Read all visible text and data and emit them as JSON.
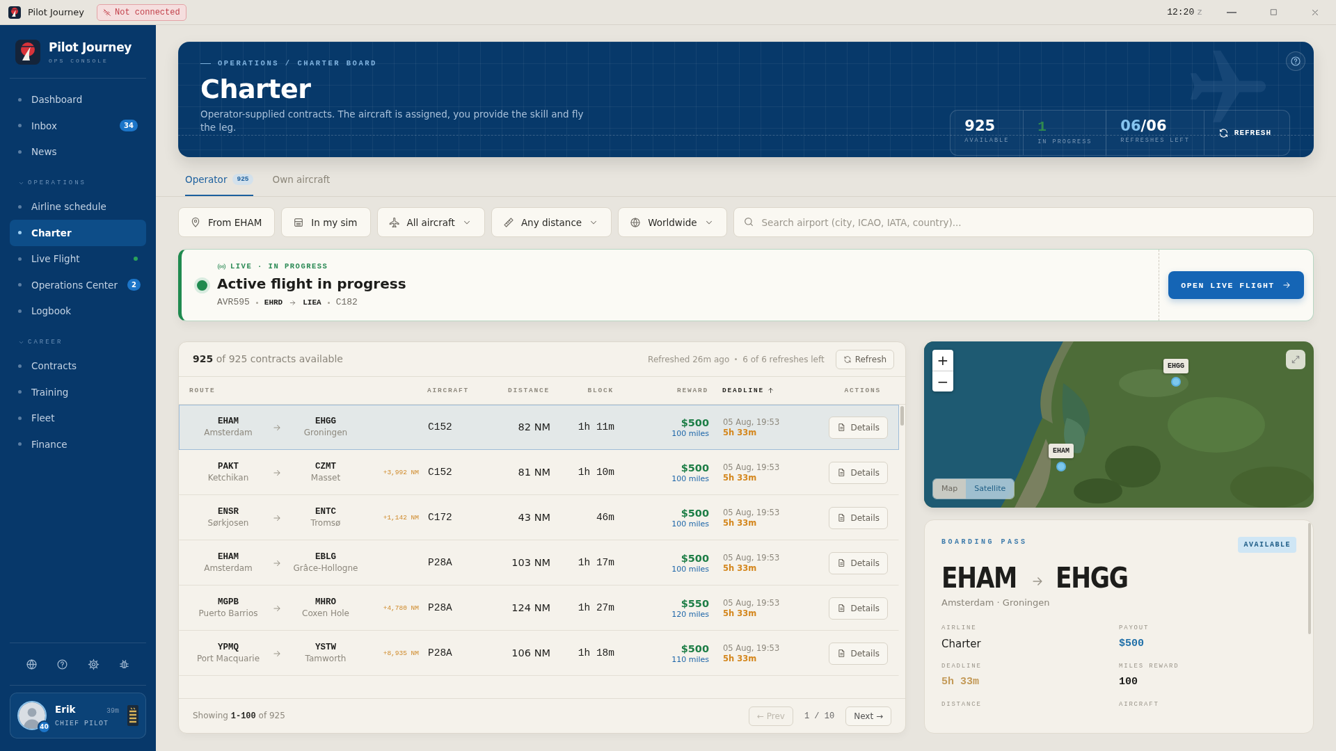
{
  "titlebar": {
    "app_title": "Pilot Journey",
    "connection": "Not connected",
    "clock": "12:20",
    "clock_zone": "z"
  },
  "sidebar": {
    "brand": {
      "name": "Pilot Journey",
      "subtitle": "OPS CONSOLE"
    },
    "groups": [
      {
        "items": [
          {
            "label": "Dashboard",
            "selected": false,
            "live": false
          },
          {
            "label": "Inbox",
            "badge": "34",
            "selected": false,
            "live": false
          },
          {
            "label": "News",
            "selected": false,
            "live": false
          }
        ]
      },
      {
        "heading": "OPERATIONS",
        "expanded": true,
        "items": [
          {
            "label": "Airline schedule",
            "selected": false,
            "live": false
          },
          {
            "label": "Charter",
            "selected": true,
            "live": false
          },
          {
            "label": "Live Flight",
            "selected": false,
            "live": true
          },
          {
            "label": "Operations Center",
            "badge": "2",
            "selected": false,
            "live": false
          },
          {
            "label": "Logbook",
            "selected": false,
            "live": false
          }
        ]
      },
      {
        "heading": "CAREER",
        "expanded": true,
        "items": [
          {
            "label": "Contracts",
            "selected": false,
            "live": false
          },
          {
            "label": "Training",
            "selected": false,
            "live": false
          },
          {
            "label": "Fleet",
            "selected": false,
            "live": false
          },
          {
            "label": "Finance",
            "selected": false,
            "live": false
          }
        ]
      }
    ],
    "user": {
      "name": "Erik",
      "role": "CHIEF PILOT",
      "time": "39m",
      "level": "40"
    }
  },
  "header": {
    "breadcrumb": "OPERATIONS / CHARTER BOARD",
    "title": "Charter",
    "description": "Operator-supplied contracts. The aircraft is assigned, you provide the skill and fly the leg.",
    "stats": [
      {
        "kind": "count",
        "value": "925",
        "label": "AVAILABLE"
      },
      {
        "kind": "active",
        "value": "1",
        "label": "IN PROGRESS"
      },
      {
        "kind": "ratio",
        "value": "06",
        "separator": "/",
        "total": "06",
        "label": "REFRESHES LEFT"
      }
    ],
    "refresh_button": "REFRESH"
  },
  "tabs": [
    {
      "label": "Operator",
      "badge": "925",
      "selected": true
    },
    {
      "label": "Own aircraft",
      "selected": false
    }
  ],
  "filters": [
    {
      "kind": "origin",
      "label": "From EHAM",
      "dropdown": false
    },
    {
      "kind": "sim",
      "label": "In my sim",
      "dropdown": false
    },
    {
      "kind": "aircraft",
      "label": "All aircraft",
      "dropdown": true
    },
    {
      "kind": "distance",
      "label": "Any distance",
      "dropdown": true
    },
    {
      "kind": "region",
      "label": "Worldwide",
      "dropdown": true
    }
  ],
  "search": {
    "placeholder": "Search airport (city, ICAO, IATA, country)..."
  },
  "live_flight": {
    "tag": "LIVE · IN PROGRESS",
    "title": "Active flight in progress",
    "callsign": "AVR595",
    "from": "EHRD",
    "to": "LIEA",
    "aircraft": "C182",
    "button": "OPEN LIVE FLIGHT"
  },
  "table": {
    "summary": "**925** of 925 contracts available",
    "refreshed": "Refreshed 26m ago",
    "refreshes_left": "6 of 6 refreshes left",
    "refresh_button": "Refresh",
    "columns": [
      {
        "label": "ROUTE",
        "sorted": false
      },
      {
        "label": "AIRCRAFT",
        "sorted": false
      },
      {
        "label": "DISTANCE",
        "sorted": false
      },
      {
        "label": "BLOCK",
        "sorted": false
      },
      {
        "label": "REWARD",
        "sorted": false
      },
      {
        "label": "DEADLINE",
        "sorted": true
      },
      {
        "label": "ACTIONS",
        "sorted": false
      }
    ],
    "rows": [
      {
        "from": "EHAM",
        "from_city": "Amsterdam",
        "to": "EHGG",
        "to_city": "Groningen",
        "aircraft": "C152",
        "distance": "82 NM",
        "block": "1h 11m",
        "reward": "$500",
        "miles": "100 miles",
        "deadline": "05 Aug, 19:53",
        "remaining": "5h 33m",
        "action": "Details",
        "selected": true
      },
      {
        "from": "PAKT",
        "from_city": "Ketchikan",
        "to": "CZMT",
        "to_city": "Masset",
        "offset": "+3,992 NM",
        "aircraft": "C152",
        "distance": "81 NM",
        "block": "1h 10m",
        "reward": "$500",
        "miles": "100 miles",
        "deadline": "05 Aug, 19:53",
        "remaining": "5h 33m",
        "action": "Details",
        "selected": false
      },
      {
        "from": "ENSR",
        "from_city": "Sørkjosen",
        "to": "ENTC",
        "to_city": "Tromsø",
        "offset": "+1,142 NM",
        "aircraft": "C172",
        "distance": "43 NM",
        "block": "46m",
        "reward": "$500",
        "miles": "100 miles",
        "deadline": "05 Aug, 19:53",
        "remaining": "5h 33m",
        "action": "Details",
        "selected": false
      },
      {
        "from": "EHAM",
        "from_city": "Amsterdam",
        "to": "EBLG",
        "to_city": "Grâce-Hollogne",
        "aircraft": "P28A",
        "distance": "103 NM",
        "block": "1h 17m",
        "reward": "$500",
        "miles": "100 miles",
        "deadline": "05 Aug, 19:53",
        "remaining": "5h 33m",
        "action": "Details",
        "selected": false
      },
      {
        "from": "MGPB",
        "from_city": "Puerto Barrios",
        "to": "MHRO",
        "to_city": "Coxen Hole",
        "offset": "+4,780 NM",
        "aircraft": "P28A",
        "distance": "124 NM",
        "block": "1h 27m",
        "reward": "$550",
        "miles": "120 miles",
        "deadline": "05 Aug, 19:53",
        "remaining": "5h 33m",
        "action": "Details",
        "selected": false
      },
      {
        "from": "YPMQ",
        "from_city": "Port Macquarie",
        "to": "YSTW",
        "to_city": "Tamworth",
        "offset": "+8,935 NM",
        "aircraft": "P28A",
        "distance": "106 NM",
        "block": "1h 18m",
        "reward": "$500",
        "miles": "110 miles",
        "deadline": "05 Aug, 19:53",
        "remaining": "5h 33m",
        "action": "Details",
        "selected": false
      }
    ],
    "footer": {
      "showing": "Showing **1-100** of 925",
      "prev": {
        "label": "← Prev",
        "disabled": true
      },
      "page_indicator": "1 / 10",
      "next": {
        "label": "Next →",
        "disabled": false
      }
    }
  },
  "map": {
    "zoom_in": "+",
    "zoom_out": "−",
    "layers": [
      {
        "label": "Map",
        "selected": false
      },
      {
        "label": "Satellite",
        "selected": true
      }
    ],
    "markers": [
      {
        "label": "EHGG"
      },
      {
        "label": "EHAM"
      }
    ]
  },
  "boarding_pass": {
    "heading": "BOARDING PASS",
    "status": "AVAILABLE",
    "from": "EHAM",
    "to": "EHGG",
    "cities": "Amsterdam · Groningen",
    "fields": [
      {
        "label": "AIRLINE",
        "value": "Charter",
        "kind": "text"
      },
      {
        "label": "PAYOUT",
        "value": "$500",
        "kind": "money"
      },
      {
        "label": "DEADLINE",
        "value": "5h 33m",
        "kind": "time"
      },
      {
        "label": "MILES REWARD",
        "value": "100",
        "kind": "number"
      },
      {
        "label": "DISTANCE"
      },
      {
        "label": "AIRCRAFT"
      }
    ]
  }
}
